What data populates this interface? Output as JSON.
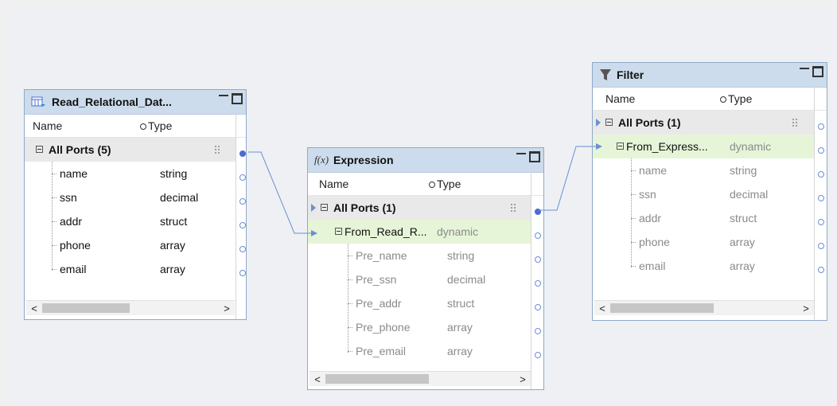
{
  "nodes": {
    "read": {
      "title": "Read_Relational_Dat...",
      "header": {
        "name": "Name",
        "type": "Type"
      },
      "group": "All Ports (5)",
      "rows": [
        {
          "name": "name",
          "type": "string"
        },
        {
          "name": "ssn",
          "type": "decimal"
        },
        {
          "name": "addr",
          "type": "struct"
        },
        {
          "name": "phone",
          "type": "array"
        },
        {
          "name": "email",
          "type": "array"
        }
      ],
      "scroll_left": "<",
      "scroll_right": ">"
    },
    "expression": {
      "title": "Expression",
      "icon": "f(x)",
      "header": {
        "name": "Name",
        "type": "Type"
      },
      "group": "All Ports (1)",
      "sub": {
        "name": "From_Read_R...",
        "type": "dynamic"
      },
      "rows": [
        {
          "name": "Pre_name",
          "type": "string"
        },
        {
          "name": "Pre_ssn",
          "type": "decimal"
        },
        {
          "name": "Pre_addr",
          "type": "struct"
        },
        {
          "name": "Pre_phone",
          "type": "array"
        },
        {
          "name": "Pre_email",
          "type": "array"
        }
      ],
      "scroll_left": "<",
      "scroll_right": ">"
    },
    "filter": {
      "title": "Filter",
      "header": {
        "name": "Name",
        "type": "Type"
      },
      "group": "All Ports (1)",
      "sub": {
        "name": "From_Express...",
        "type": "dynamic"
      },
      "rows": [
        {
          "name": "name",
          "type": "string"
        },
        {
          "name": "ssn",
          "type": "decimal"
        },
        {
          "name": "addr",
          "type": "struct"
        },
        {
          "name": "phone",
          "type": "array"
        },
        {
          "name": "email",
          "type": "array"
        }
      ],
      "scroll_left": "<",
      "scroll_right": ">"
    }
  },
  "colors": {
    "link": "#6b8ed6",
    "title_bg": "#ccdcec",
    "sub_bg": "#e6f5d8"
  },
  "icons": {
    "read": "table-read-icon",
    "expression": "function-icon",
    "filter": "funnel-icon"
  }
}
